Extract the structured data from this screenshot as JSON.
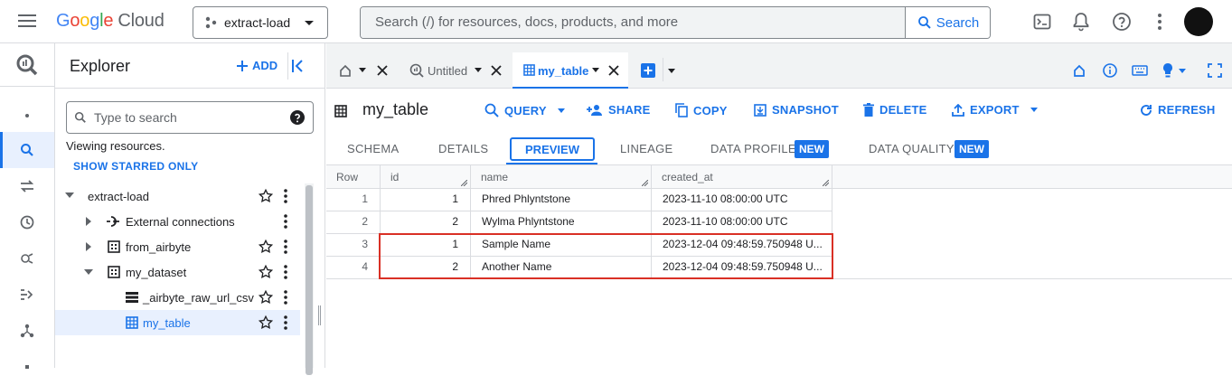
{
  "header": {
    "logo_google": [
      "G",
      "o",
      "o",
      "g",
      "l",
      "e"
    ],
    "logo_cloud": "Cloud",
    "project": "extract-load",
    "search_placeholder": "Search (/) for resources, docs, products, and more",
    "search_button": "Search"
  },
  "explorer": {
    "title": "Explorer",
    "add_label": "ADD",
    "search_placeholder": "Type to search",
    "viewing": "Viewing resources.",
    "show_starred": "SHOW STARRED ONLY",
    "tree": [
      {
        "label": "extract-load"
      },
      {
        "label": "External connections"
      },
      {
        "label": "from_airbyte"
      },
      {
        "label": "my_dataset"
      },
      {
        "label": "_airbyte_raw_url_csv"
      },
      {
        "label": "my_table"
      }
    ]
  },
  "tabs": {
    "untitled": "Untitled",
    "active": "my_table"
  },
  "toolbar": {
    "title": "my_table",
    "query": "QUERY",
    "share": "SHARE",
    "copy": "COPY",
    "snapshot": "SNAPSHOT",
    "delete": "DELETE",
    "export": "EXPORT",
    "refresh": "REFRESH"
  },
  "subtabs": {
    "schema": "SCHEMA",
    "details": "DETAILS",
    "preview": "PREVIEW",
    "lineage": "LINEAGE",
    "data_profile": "DATA PROFILE",
    "data_quality": "DATA QUALITY",
    "new_badge": "NEW"
  },
  "table": {
    "columns": [
      "Row",
      "id",
      "name",
      "created_at"
    ],
    "rows": [
      [
        "1",
        "1",
        "Phred Phlyntstone",
        "2023-11-10 08:00:00 UTC"
      ],
      [
        "2",
        "2",
        "Wylma Phlyntstone",
        "2023-11-10 08:00:00 UTC"
      ],
      [
        "3",
        "1",
        "Sample Name",
        "2023-12-04 09:48:59.750948 U..."
      ],
      [
        "4",
        "2",
        "Another Name",
        "2023-12-04 09:48:59.750948 U..."
      ]
    ]
  },
  "colors": {
    "accent": "#1a73e8",
    "highlight": "#d93025"
  }
}
